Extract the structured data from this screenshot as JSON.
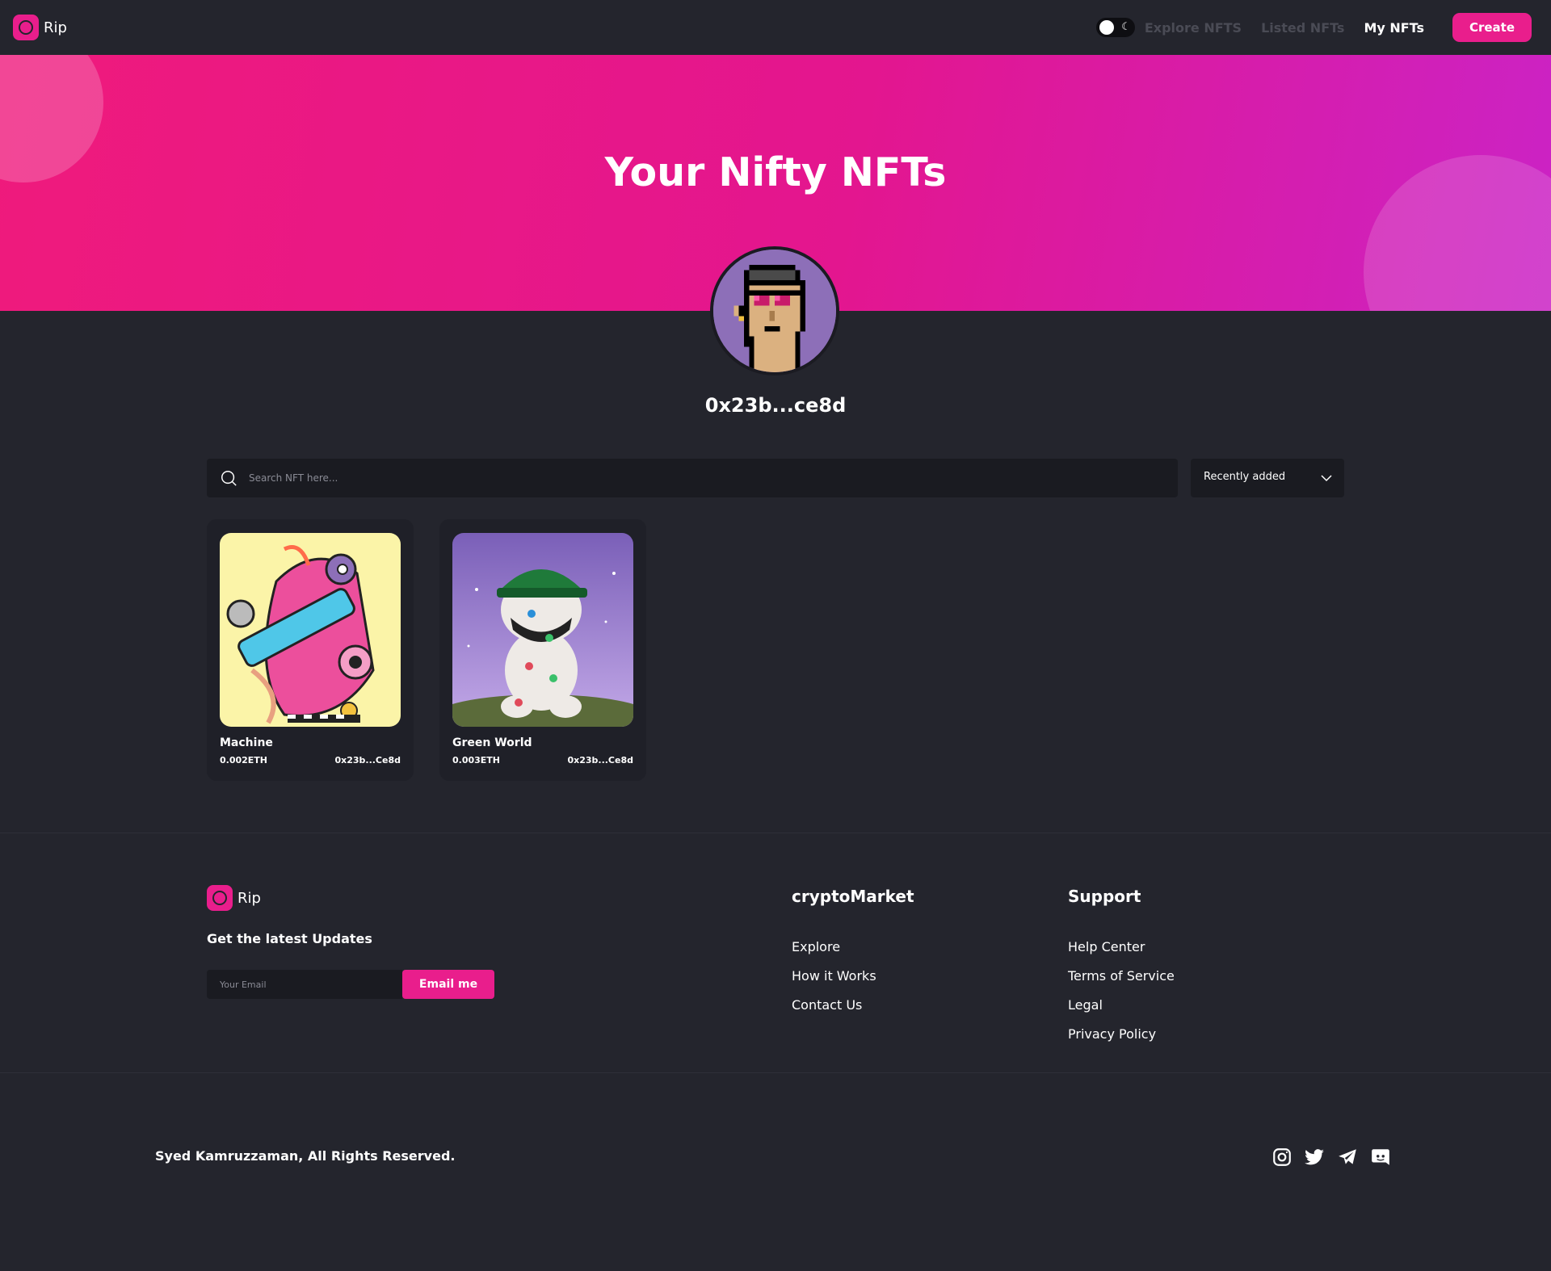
{
  "brand": {
    "name": "Rip"
  },
  "colors": {
    "accent": "#e91e8c",
    "background": "#24252d",
    "surface": "#1a1b21",
    "card": "#1f2028"
  },
  "nav": {
    "theme_toggle_icon": "moon-icon",
    "links": [
      "Explore NFTS",
      "Listed NFTs",
      "My NFTs"
    ],
    "create_label": "Create"
  },
  "hero": {
    "title": "Your Nifty NFTs"
  },
  "profile": {
    "address": "0x23b...ce8d"
  },
  "search": {
    "placeholder": "Search NFT here..."
  },
  "sort": {
    "selected": "Recently added"
  },
  "nfts": [
    {
      "name": "Machine",
      "price": "0.002ETH",
      "owner": "0x23b...Ce8d"
    },
    {
      "name": "Green World",
      "price": "0.003ETH",
      "owner": "0x23b...Ce8d"
    }
  ],
  "footer": {
    "brand": "Rip",
    "tagline": "Get the latest Updates",
    "email_placeholder": "Your Email",
    "email_button": "Email me",
    "columns": [
      {
        "heading": "cryptoMarket",
        "links": [
          "Explore",
          "How it Works",
          "Contact Us"
        ]
      },
      {
        "heading": "Support",
        "links": [
          "Help Center",
          "Terms of Service",
          "Legal",
          "Privacy Policy"
        ]
      }
    ],
    "copyright": "Syed Kamruzzaman, All Rights Reserved.",
    "social_icons": [
      "instagram-icon",
      "twitter-icon",
      "telegram-icon",
      "discord-icon"
    ]
  }
}
